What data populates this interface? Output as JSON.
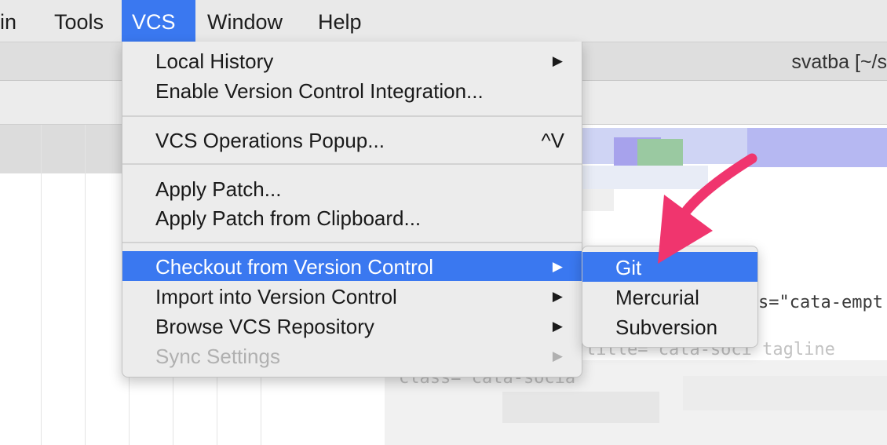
{
  "menubar": {
    "items": [
      {
        "label": "in"
      },
      {
        "label": "Tools"
      },
      {
        "label": "VCS"
      },
      {
        "label": "Window"
      },
      {
        "label": "Help"
      }
    ]
  },
  "window": {
    "title": "svatba [~/s"
  },
  "editor": {
    "code_lines": [
      "s=\"cata-empt",
      "class=\"cata-socia",
      "title=\"cata-soci tagline"
    ]
  },
  "vcs_menu": {
    "items": [
      {
        "label": "Local History",
        "arrow": "▶"
      },
      {
        "label": "Enable Version Control Integration..."
      },
      {
        "label": "VCS Operations Popup...",
        "shortcut": "^V"
      },
      {
        "label": "Apply Patch..."
      },
      {
        "label": "Apply Patch from Clipboard..."
      },
      {
        "label": "Checkout from Version Control",
        "arrow": "▶"
      },
      {
        "label": "Import into Version Control",
        "arrow": "▶"
      },
      {
        "label": "Browse VCS Repository",
        "arrow": "▶"
      },
      {
        "label": "Sync Settings",
        "arrow": "▶"
      }
    ]
  },
  "checkout_submenu": {
    "items": [
      {
        "label": "Git"
      },
      {
        "label": "Mercurial"
      },
      {
        "label": "Subversion"
      }
    ]
  },
  "colors": {
    "accent": "#3a78f0",
    "annotation_arrow": "#f0356e"
  }
}
